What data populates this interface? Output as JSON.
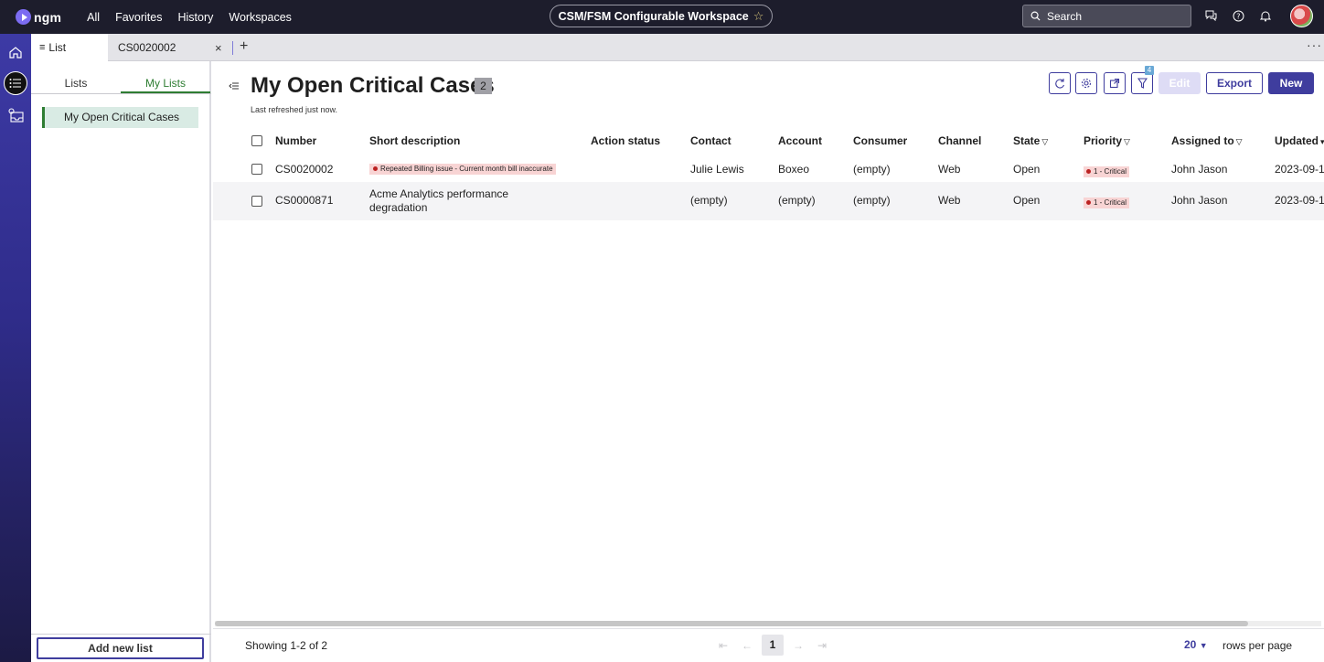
{
  "brand": {
    "name": "ngm"
  },
  "nav": {
    "items": [
      "All",
      "Favorites",
      "History",
      "Workspaces"
    ]
  },
  "workspace": {
    "title": "CSM/FSM Configurable Workspace"
  },
  "search": {
    "placeholder": "Search"
  },
  "tabs": {
    "list_label": "List",
    "case_label": "CS0020002"
  },
  "lists_panel": {
    "tab_lists": "Lists",
    "tab_my_lists": "My Lists",
    "active_item": "My Open Critical Cases",
    "add_button": "Add new list"
  },
  "main": {
    "title": "My Open Critical Cases",
    "count": "2",
    "refreshed": "Last refreshed just now.",
    "filter_count": "4",
    "edit_label": "Edit",
    "export_label": "Export",
    "new_label": "New"
  },
  "table": {
    "columns": [
      "Number",
      "Short description",
      "Action status",
      "Contact",
      "Account",
      "Consumer",
      "Channel",
      "State",
      "Priority",
      "Assigned to",
      "Updated"
    ],
    "rows": [
      {
        "number": "CS0020002",
        "description": "Repeated Billing issue - Current month bill inaccurate",
        "action_status": "",
        "contact": "Julie Lewis",
        "account": "Boxeo",
        "consumer": "(empty)",
        "channel": "Web",
        "state": "Open",
        "priority": "1 - Critical",
        "assigned_to": "John Jason",
        "updated": "2023-09-1"
      },
      {
        "number": "CS0000871",
        "description": "Acme Analytics performance degradation",
        "action_status": "",
        "contact": "(empty)",
        "account": "(empty)",
        "consumer": "(empty)",
        "channel": "Web",
        "state": "Open",
        "priority": "1 - Critical",
        "assigned_to": "John Jason",
        "updated": "2023-09-1"
      }
    ]
  },
  "footer": {
    "showing": "Showing 1-2 of 2",
    "current_page": "1",
    "rows_per_page_value": "20",
    "rows_per_page_label": "rows per page"
  },
  "colors": {
    "primary": "#3f3d9e",
    "topbar": "#1d1d2c",
    "accent_green": "#2e7d32",
    "critical_bg": "#f8d4d4"
  }
}
